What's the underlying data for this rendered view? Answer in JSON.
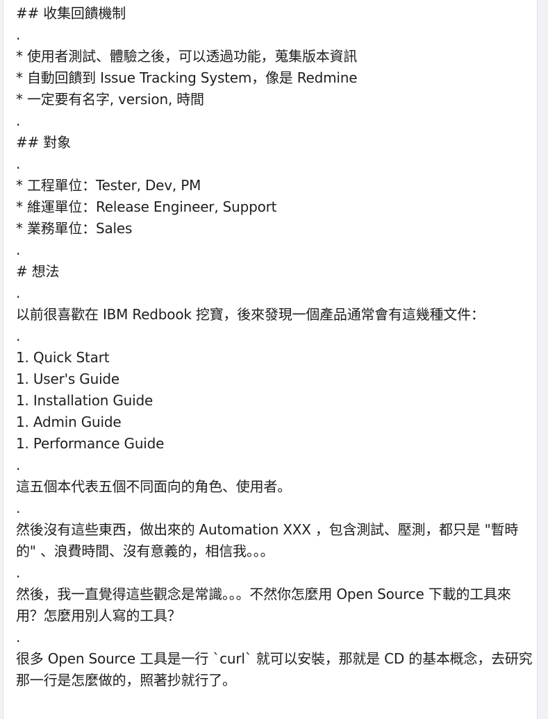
{
  "post": {
    "lines": [
      "## 收集回饋機制",
      ".",
      "* 使用者測試、體驗之後，可以透過功能，蒐集版本資訊",
      "* 自動回饋到 Issue Tracking System，像是 Redmine",
      "* 一定要有名字, version, 時間",
      ".",
      "## 對象",
      ".",
      "* 工程單位：Tester, Dev, PM",
      "* 維運單位：Release Engineer, Support",
      "* 業務單位：Sales",
      ".",
      "# 想法",
      ".",
      "以前很喜歡在 IBM Redbook 挖寶，後來發現一個產品通常會有這幾種文件：",
      ".",
      "1. Quick Start",
      "1. User's Guide",
      "1. Installation Guide",
      "1. Admin Guide",
      "1. Performance Guide",
      ".",
      "這五個本代表五個不同面向的角色、使用者。",
      ".",
      "然後沒有這些東西，做出來的 Automation XXX ，包含測試、壓測，都只是 \"暫時的\" 、浪費時間、沒有意義的，相信我。。。",
      ".",
      "然後，我一直覺得這些觀念是常識。。。不然你怎麼用 Open Source 下載的工具來用？怎麼用別人寫的工具？",
      ".",
      "很多 Open Source 工具是一行 `curl` 就可以安裝，那就是 CD 的基本概念，去研究那一行是怎麼做的，照著抄就行了。"
    ]
  }
}
